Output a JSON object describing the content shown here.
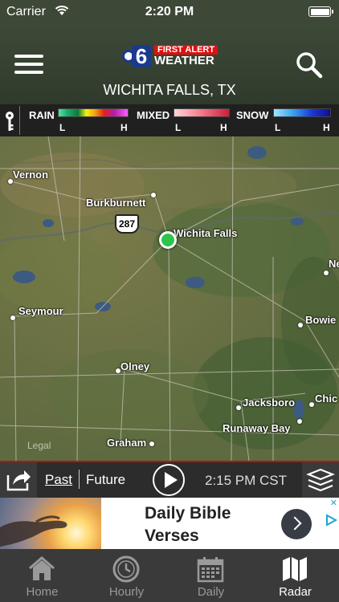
{
  "status_bar": {
    "carrier": "Carrier",
    "time": "2:20 PM"
  },
  "header": {
    "logo": {
      "number": "6",
      "line1": "FIRST ALERT",
      "line2": "WEATHER"
    },
    "location": "WICHITA FALLS, TX"
  },
  "legend": {
    "rain": {
      "label": "RAIN",
      "low": "L",
      "high": "H"
    },
    "mixed": {
      "label": "MIXED",
      "low": "L",
      "high": "H"
    },
    "snow": {
      "label": "SNOW",
      "low": "L",
      "high": "H"
    }
  },
  "map": {
    "cities": [
      "Vernon",
      "Burkburnett",
      "Wichita Falls",
      "Seymour",
      "Bowie",
      "Olney",
      "Jacksboro",
      "Chic",
      "Runaway Bay",
      "Graham",
      "Ne"
    ],
    "highway_shield": "287",
    "legal": "Legal"
  },
  "playback": {
    "past_label": "Past",
    "future_label": "Future",
    "time": "2:15 PM CST"
  },
  "ad": {
    "title_line1": "Daily Bible",
    "title_line2": "Verses"
  },
  "nav": {
    "items": [
      {
        "label": "Home",
        "icon": "home-icon",
        "active": false
      },
      {
        "label": "Hourly",
        "icon": "clock-icon",
        "active": false
      },
      {
        "label": "Daily",
        "icon": "calendar-icon",
        "active": false
      },
      {
        "label": "Radar",
        "icon": "map-icon",
        "active": true
      }
    ]
  }
}
